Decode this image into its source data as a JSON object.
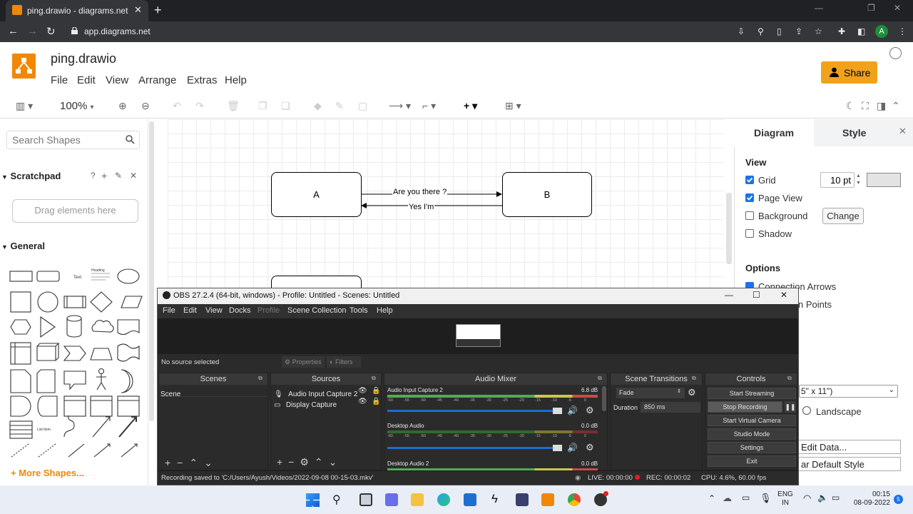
{
  "browser": {
    "tab_title": "ping.drawio - diagrams.net",
    "url": "app.diagrams.net",
    "avatar_initial": "A"
  },
  "drawio": {
    "file_name": "ping.drawio",
    "menu": [
      "File",
      "Edit",
      "View",
      "Arrange",
      "Extras",
      "Help"
    ],
    "share_label": "Share",
    "zoom": "100%",
    "search_placeholder": "Search Shapes",
    "scratchpad_label": "Scratchpad",
    "scratchpad_help": "?",
    "drag_hint": "Drag elements here",
    "general_label": "General",
    "more_shapes": "+ More Shapes...",
    "shape_text_label": "Text",
    "shape_heading_label": "Heading",
    "shape_listitem_label": "List Item",
    "diagram": {
      "node_a": "A",
      "node_b": "B",
      "edge_forward": "Are you there ?",
      "edge_back": "Yes I'm"
    },
    "panel": {
      "tab_diagram": "Diagram",
      "tab_style": "Style",
      "view_heading": "View",
      "grid_label": "Grid",
      "grid_checked": true,
      "grid_size": "10 pt",
      "pageview_label": "Page View",
      "pageview_checked": true,
      "background_label": "Background",
      "background_checked": false,
      "change_label": "Change",
      "shadow_label": "Shadow",
      "shadow_checked": false,
      "options_heading": "Options",
      "connection_arrows": "Connection Arrows",
      "connection_points": "n Points",
      "paper_size": "5\" x 11\")",
      "landscape": "Landscape",
      "edit_data": "Edit Data...",
      "default_style": "ar Default Style"
    }
  },
  "obs": {
    "title": "OBS 27.2.4 (64-bit, windows) - Profile: Untitled - Scenes: Untitled",
    "menu": [
      "File",
      "Edit",
      "View",
      "Docks",
      "Profile",
      "Scene Collection",
      "Tools",
      "Help"
    ],
    "no_source": "No source selected",
    "properties": "Properties",
    "filters": "Filters",
    "scenes_header": "Scenes",
    "scenes": [
      "Scene"
    ],
    "sources_header": "Sources",
    "sources": [
      "Audio Input Capture 2",
      "Display Capture"
    ],
    "mixer_header": "Audio Mixer",
    "mixer": [
      {
        "name": "Audio Input Capture 2",
        "db": "6.8 dB"
      },
      {
        "name": "Desktop Audio",
        "db": "0.0 dB"
      },
      {
        "name": "Desktop Audio 2",
        "db": "0.0 dB"
      }
    ],
    "meter_ticks": [
      "-60",
      "-55",
      "-50",
      "-45",
      "-40",
      "-35",
      "-30",
      "-25",
      "-20",
      "-15",
      "-10",
      "-5",
      "0"
    ],
    "transitions_header": "Scene Transitions",
    "transition": "Fade",
    "duration_label": "Duration",
    "duration_value": "850 ms",
    "controls_header": "Controls",
    "controls": [
      "Start Streaming",
      "Stop Recording",
      "Start Virtual Camera",
      "Studio Mode",
      "Settings",
      "Exit"
    ],
    "status_saved": "Recording saved to 'C:/Users/Ayush/Videos/2022-09-08 00-15-03.mkv'",
    "live": "LIVE: 00:00:00",
    "rec": "REC: 00:00:02",
    "cpu": "CPU: 4.6%, 60.00 fps"
  },
  "taskbar": {
    "lang_1": "ENG",
    "lang_2": "IN",
    "time": "00:15",
    "date": "08-09-2022",
    "notif": "5"
  },
  "colors": {
    "drawio_orange": "#f08705",
    "share_btn": "#f1a21b",
    "checkbox_blue": "#1a73e8",
    "obs_bg": "#2b2b2b"
  }
}
